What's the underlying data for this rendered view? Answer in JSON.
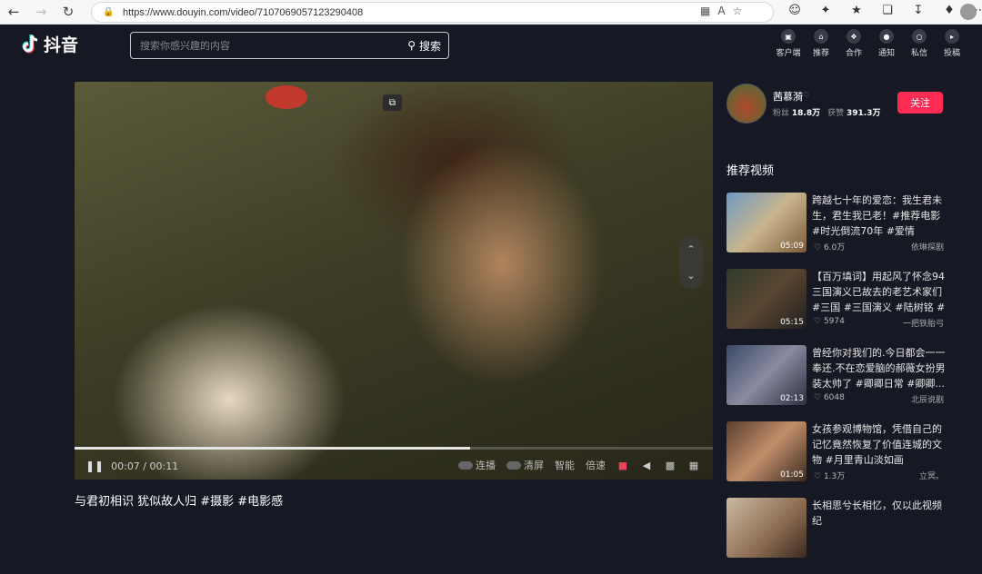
{
  "browser": {
    "url": "https://www.douyin.com/video/7107069057123290408"
  },
  "header": {
    "logo_text": "抖音",
    "search_placeholder": "搜索你感兴趣的内容",
    "search_button": "搜索",
    "actions": [
      {
        "label": "客户端",
        "icon": "monitor-icon"
      },
      {
        "label": "推荐",
        "icon": "home-icon"
      },
      {
        "label": "合作",
        "icon": "handshake-icon"
      },
      {
        "label": "通知",
        "icon": "bell-icon"
      },
      {
        "label": "私信",
        "icon": "chat-icon"
      },
      {
        "label": "投稿",
        "icon": "upload-icon"
      }
    ]
  },
  "video": {
    "current_time": "00:07",
    "total_time": "00:11",
    "time_separator": " / ",
    "progress": 0.62,
    "controls": {
      "autoplay": "连播",
      "clear": "清屏",
      "smart": "智能",
      "speed": "倍速"
    },
    "title": "与君初相识 犹似故人归 #摄影 #电影感"
  },
  "author": {
    "name": "茜慕漪",
    "fans_label": "粉丝",
    "fans": "18.8万",
    "likes_label": "获赞",
    "likes": "391.3万",
    "follow": "关注"
  },
  "recommend": {
    "title": "推荐视频",
    "items": [
      {
        "text": "跨越七十年的爱恋：我生君未生，君生我已老！#推荐电影 #时光倒流70年 #爱情",
        "duration": "05:09",
        "likes": "6.0万",
        "author": "依琳探剧"
      },
      {
        "text": "【百万填词】用起风了怀念94三国演义已故去的老艺术家们 #三国 #三国演义 #陆树铭 #陆...",
        "duration": "05:15",
        "likes": "5974",
        "author": "一把铁胎弓"
      },
      {
        "text": "曾经你对我们的.今日都会一一奉还.不在恋爱脑的郝薇女扮男装太帅了 #卿卿日常 #卿卿...",
        "duration": "02:13",
        "likes": "6048",
        "author": "北辰说剧"
      },
      {
        "text": "女孩参观博物馆，凭借自己的记忆竟然恢复了价值连城的文物 #月里青山淡如画",
        "duration": "01:05",
        "likes": "1.3万",
        "author": "立冥。"
      },
      {
        "text": "长相思兮长相忆，仅以此视频纪",
        "duration": "",
        "likes": "",
        "author": ""
      }
    ]
  }
}
